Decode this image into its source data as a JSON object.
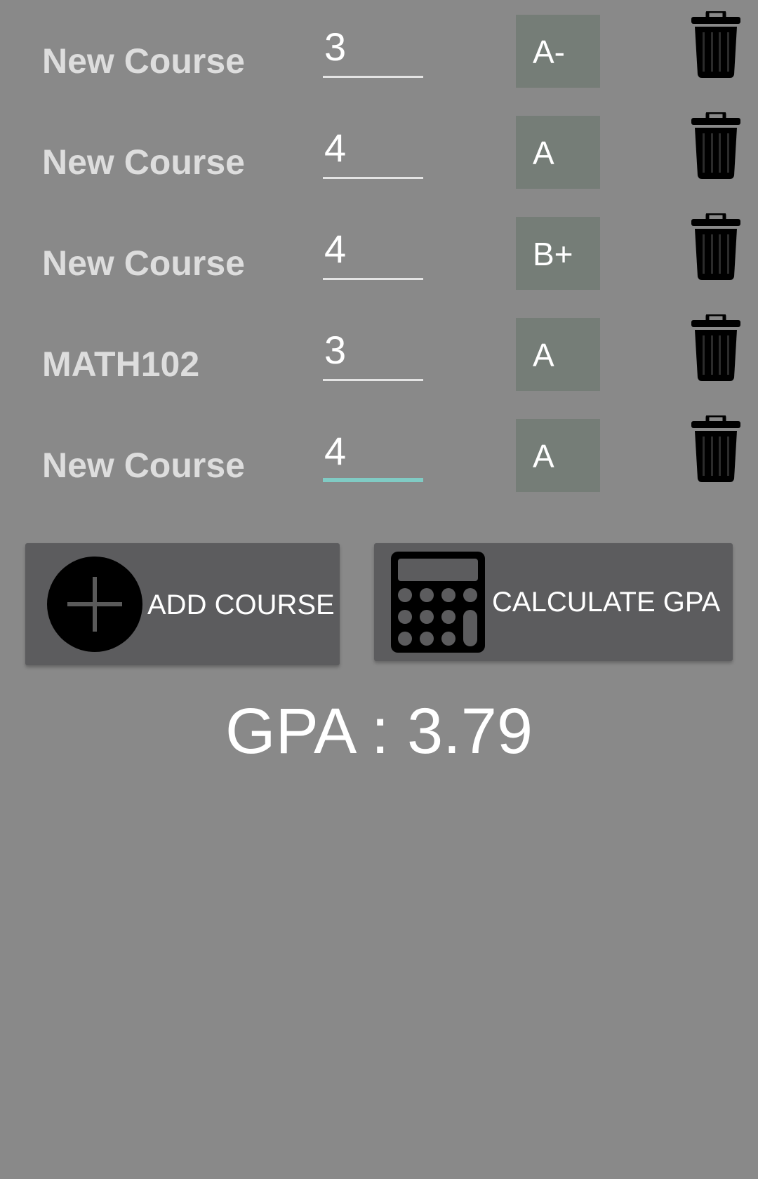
{
  "courses": [
    {
      "name": "New Course",
      "credits": "3",
      "grade": "A-"
    },
    {
      "name": "New Course",
      "credits": "4",
      "grade": "A"
    },
    {
      "name": "New Course",
      "credits": "4",
      "grade": "B+"
    },
    {
      "name": "MATH102",
      "credits": "3",
      "grade": "A"
    },
    {
      "name": "New Course",
      "credits": "4",
      "grade": "A"
    }
  ],
  "actions": {
    "add_course_label": "ADD COURSE",
    "add_course_icon": "plus-circle-icon",
    "calculate_gpa_label": "CALCULATE GPA",
    "calculate_gpa_icon": "calculator-icon",
    "delete_icon": "trash-icon"
  },
  "result": {
    "gpa_text": "GPA : 3.79"
  },
  "colors": {
    "background": "#898989",
    "grade_box": "#757d77",
    "button": "#5c5c5e",
    "focus_underline": "#80cbc4"
  }
}
